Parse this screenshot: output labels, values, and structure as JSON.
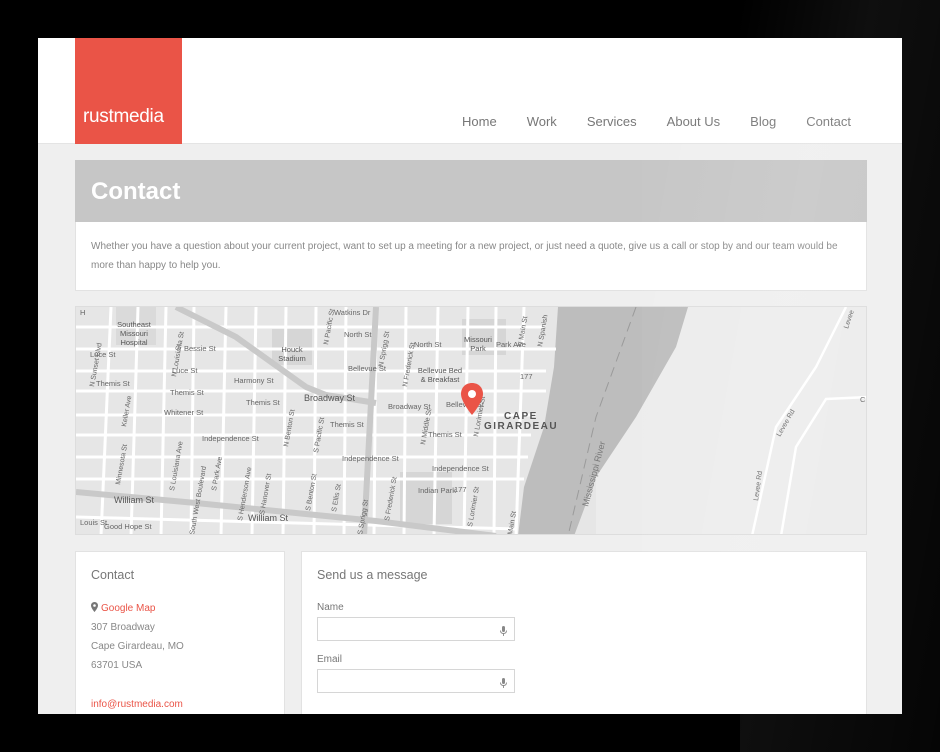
{
  "brand": {
    "logo_text": "rustmedia",
    "accent": "#ea5447"
  },
  "nav": {
    "items": [
      {
        "label": "Home"
      },
      {
        "label": "Work"
      },
      {
        "label": "Services"
      },
      {
        "label": "About Us"
      },
      {
        "label": "Blog"
      },
      {
        "label": "Contact"
      }
    ]
  },
  "page": {
    "title": "Contact",
    "intro": "Whether you have a question about your current project, want to set up a meeting for a new project, or just need a quote, give us a call or stop by and our team would be more than happy to help you."
  },
  "map": {
    "city_label_line1": "CAPE",
    "city_label_line2": "GIRARDEAU",
    "river_label": "Mississippi River",
    "labels": {
      "hospital": "Southeast Missouri Hospital",
      "hospital_line1": "Southeast",
      "hospital_line2": "Missouri",
      "hospital_line3": "Hospital",
      "stadium_line1": "Houck",
      "stadium_line2": "Stadium",
      "missouri_park_line1": "Missouri",
      "missouri_park_line2": "Park",
      "bellevue_bed_line1": "Bellevue Bed",
      "bellevue_bed_line2": "& Breakfast",
      "indian_park": "Indian Park",
      "watkins": "Watkins Dr",
      "north_st_1": "North St",
      "north_st_2": "North St",
      "park_ave": "Park Ave",
      "bessie": "Bessie St",
      "luce_1": "Luce St",
      "luce_2": "Luce St",
      "harmony": "Harmony St",
      "bellevue_1": "Bellevue St",
      "bellevue_2": "Bellevue St",
      "themis_1": "Themis St",
      "themis_2": "Themis St",
      "themis_3": "Themis St",
      "themis_4": "Themis St",
      "themis_5": "Themis St",
      "broadway_1": "Broadway St",
      "broadway_2": "Broadway St",
      "whitener": "Whitener St",
      "independence_1": "Independence St",
      "independence_2": "Independence St",
      "independence_3": "Independence St",
      "william_1": "William St",
      "william_2": "William St",
      "good_hope": "Good Hope St",
      "louis": "Louis St",
      "n_sprigg": "N Sprigg St",
      "s_sprigg": "S Sprigg St",
      "n_frederick": "N Frederick St",
      "s_frederick": "S Frederick St",
      "n_middle": "N Middle St",
      "n_lorimier": "N Lorimier St",
      "s_lorimier": "S Lorimier St",
      "n_main": "N Main St",
      "main": "Main St",
      "n_spanish": "N Spanish",
      "n_pacific": "N Pacific St",
      "s_pacific": "S Pacific St",
      "n_benton": "N Benton St",
      "s_benton": "S Benton St",
      "s_hanover": "S Hanover St",
      "s_henderson": "S Henderson Ave",
      "s_ellis": "S Ellis St",
      "keller": "Keller Ave",
      "minnesota": "Minnesota St",
      "n_sunset": "N Sunset Blvd",
      "n_louisiana": "N Louisiana St",
      "s_louisiana": "S Louisiana Ave",
      "s_park": "S Park Ave",
      "s_ellis_2": "S Ellis St",
      "s_boulevard": "South West Boulevard",
      "levee_rd": "Levee Rd",
      "levee_rd_2": "Levee Rd",
      "levee_3": "Levee",
      "route_1": "177",
      "route_2": "177",
      "st": "St",
      "h": "H",
      "c": "C"
    }
  },
  "contact_card": {
    "title": "Contact",
    "map_link": "Google Map",
    "address_line1": "307 Broadway",
    "address_line2": "Cape Girardeau, MO",
    "address_line3": "63701 USA",
    "email": "info@rustmedia.com"
  },
  "form": {
    "title": "Send us a message",
    "name_label": "Name",
    "name_value": "",
    "email_label": "Email",
    "email_value": ""
  }
}
